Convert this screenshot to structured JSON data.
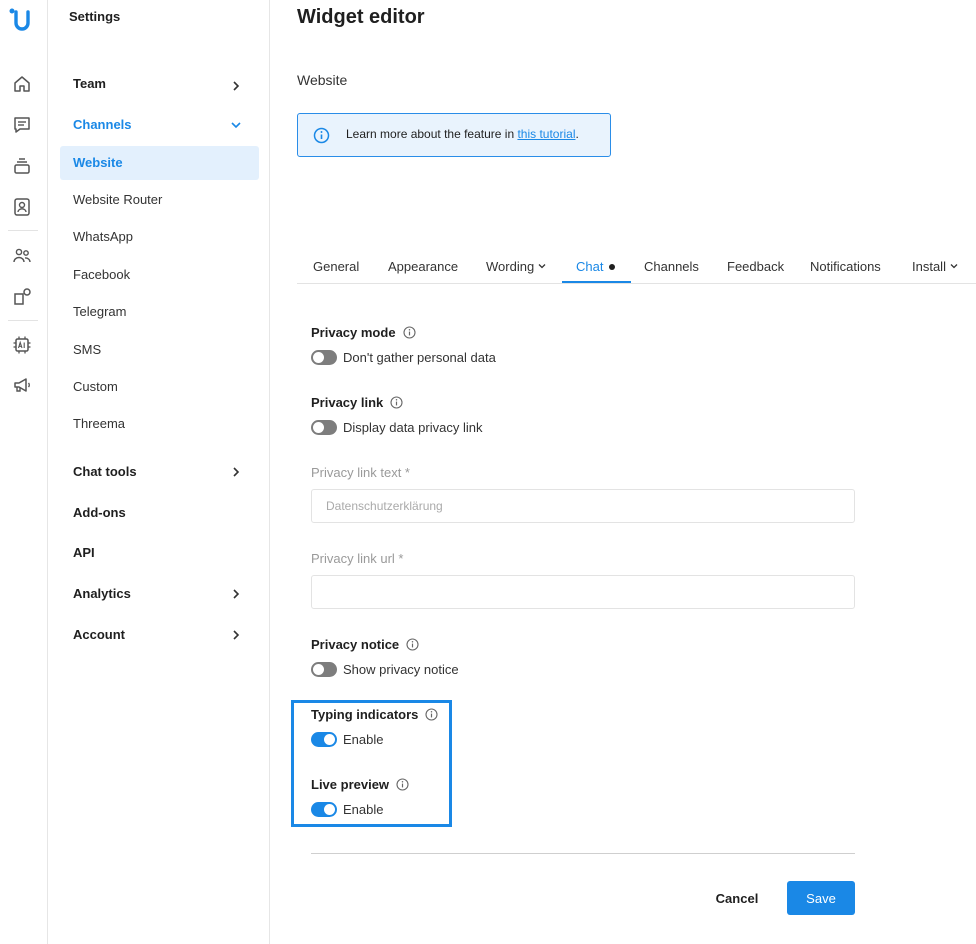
{
  "sidebar": {
    "title": "Settings",
    "team": "Team",
    "channels": "Channels",
    "channel_items": [
      "Website",
      "Website Router",
      "WhatsApp",
      "Facebook",
      "Telegram",
      "SMS",
      "Custom",
      "Threema"
    ],
    "chat_tools": "Chat tools",
    "addons": "Add-ons",
    "api": "API",
    "analytics": "Analytics",
    "account": "Account"
  },
  "rail": {
    "icons": [
      "logo-icon",
      "home-icon",
      "chat-icon",
      "inbox-stack-icon",
      "contacts-icon",
      "team-icon",
      "apps-icon",
      "ai-chip-icon",
      "megaphone-icon"
    ]
  },
  "main": {
    "title": "Widget editor",
    "subtitle": "Website",
    "info_text": "Learn more about the feature in ",
    "info_link": "this tutorial",
    "info_suffix": "."
  },
  "tabs": [
    "General",
    "Appearance",
    "Wording",
    "Chat",
    "Channels",
    "Feedback",
    "Notifications",
    "Install"
  ],
  "form": {
    "privacy_mode": {
      "label": "Privacy mode",
      "toggle": "Don't gather personal data",
      "on": false
    },
    "privacy_link": {
      "label": "Privacy link",
      "toggle": "Display data privacy link",
      "on": false
    },
    "privacy_link_text": {
      "label": "Privacy link text *",
      "placeholder": "Datenschutzerklärung",
      "value": ""
    },
    "privacy_link_url": {
      "label": "Privacy link url *",
      "value": ""
    },
    "privacy_notice": {
      "label": "Privacy notice",
      "toggle": "Show privacy notice",
      "on": false
    },
    "typing_indicators": {
      "label": "Typing indicators",
      "toggle": "Enable",
      "on": true
    },
    "live_preview": {
      "label": "Live preview",
      "toggle": "Enable",
      "on": true
    }
  },
  "buttons": {
    "cancel": "Cancel",
    "save": "Save"
  },
  "colors": {
    "accent": "#1a88e6",
    "toggle_off": "#7d7d7d",
    "info_bg": "#e9f3fd"
  }
}
